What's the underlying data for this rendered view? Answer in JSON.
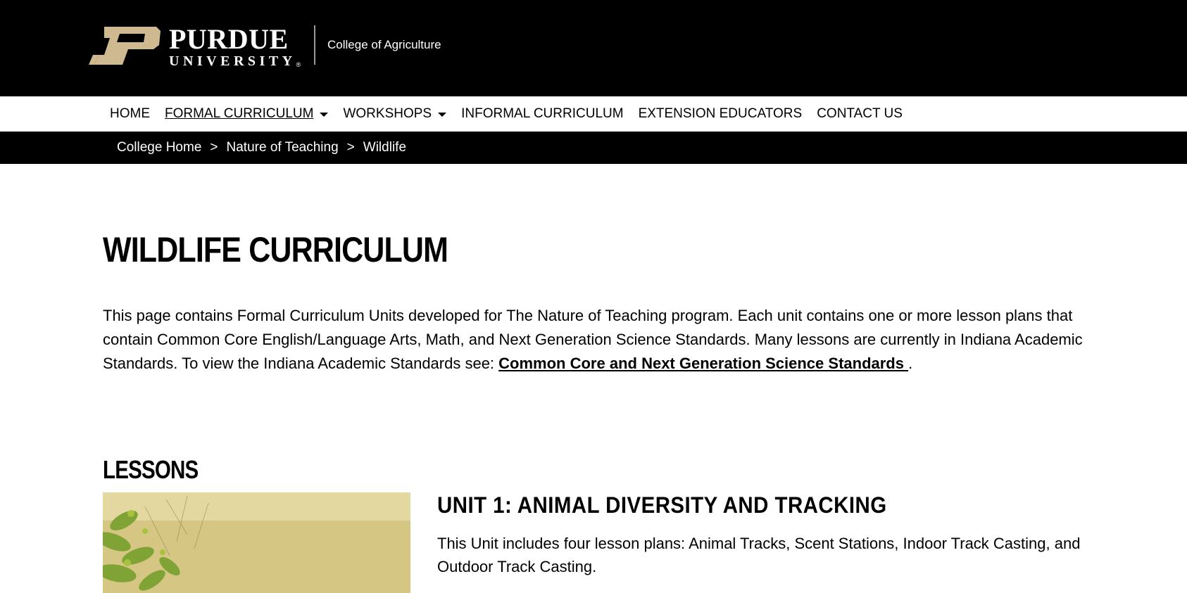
{
  "header": {
    "university_name": "PURDUE",
    "university_sub": "UNIVERSITY",
    "registered_mark": "®",
    "college_name": "College of Agriculture",
    "brand_colors": {
      "black": "#000000",
      "gold": "#CFB991"
    }
  },
  "nav": {
    "items": [
      {
        "label": "HOME",
        "has_dropdown": false
      },
      {
        "label": "FORMAL CURRICULUM",
        "has_dropdown": true,
        "active": true
      },
      {
        "label": "WORKSHOPS",
        "has_dropdown": true
      },
      {
        "label": "INFORMAL CURRICULUM",
        "has_dropdown": false
      },
      {
        "label": "EXTENSION EDUCATORS",
        "has_dropdown": false
      },
      {
        "label": "CONTACT US",
        "has_dropdown": false
      }
    ]
  },
  "breadcrumb": {
    "items": [
      "College Home",
      "Nature of Teaching",
      "Wildlife"
    ],
    "separator": ">"
  },
  "main": {
    "title": "WILDLIFE CURRICULUM",
    "intro_text": "This page contains Formal Curriculum Units developed for The Nature of Teaching program. Each unit contains one or more lesson plans that contain Common Core English/Language Arts, Math, and Next Generation Science Standards. Many lessons are currently in Indiana Academic Standards. To view the Indiana Academic Standards see: ",
    "intro_link": "Common Core and Next Generation Science Standards ",
    "intro_end": ".",
    "lessons_heading": "LESSONS",
    "units": [
      {
        "title": "UNIT 1: ANIMAL DIVERSITY AND TRACKING",
        "description": "This Unit includes four lesson plans: Animal Tracks, Scent Stations, Indoor Track Casting, and Outdoor Track Casting."
      }
    ]
  }
}
